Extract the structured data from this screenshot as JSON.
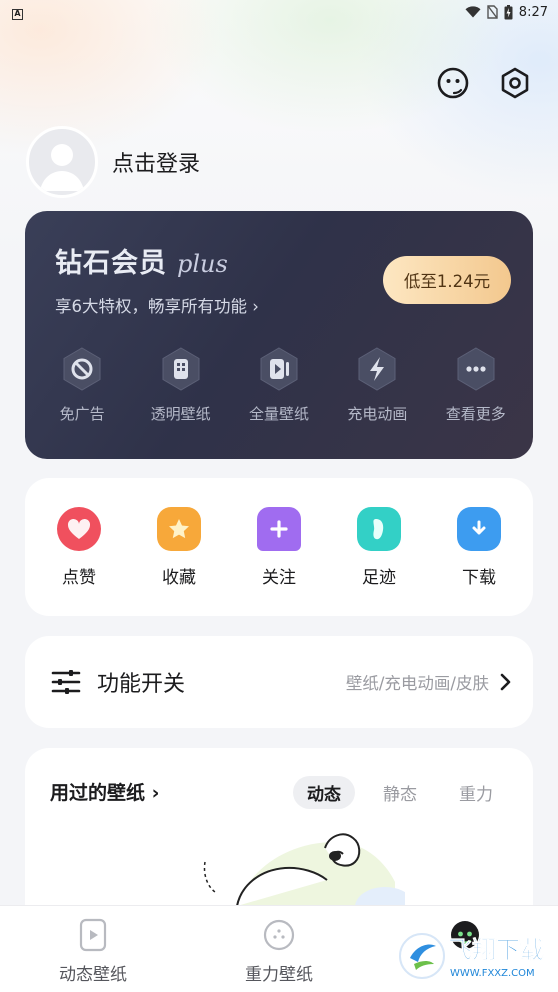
{
  "status_bar": {
    "time": "8:27",
    "app_mark": "A"
  },
  "profile": {
    "login_text": "点击登录"
  },
  "vip": {
    "title": "钻石会员",
    "title_suffix": "plus",
    "subtitle": "享6大特权，畅享所有功能 ›",
    "price_button": "低至1.24元",
    "perks": [
      {
        "label": "免广告",
        "icon": "no-ads-icon"
      },
      {
        "label": "透明壁纸",
        "icon": "transparent-wallpaper-icon"
      },
      {
        "label": "全量壁纸",
        "icon": "all-wallpapers-icon"
      },
      {
        "label": "充电动画",
        "icon": "charging-bolt-icon"
      },
      {
        "label": "查看更多",
        "icon": "more-dots-icon"
      }
    ]
  },
  "quick_actions": [
    {
      "label": "点赞",
      "icon": "heart-icon",
      "color": "#f0505e"
    },
    {
      "label": "收藏",
      "icon": "star-icon",
      "color": "#f7a83a"
    },
    {
      "label": "关注",
      "icon": "bookmark-plus-icon",
      "color": "#a06cf0"
    },
    {
      "label": "足迹",
      "icon": "footprint-icon",
      "color": "#33d0c6"
    },
    {
      "label": "下载",
      "icon": "download-folder-icon",
      "color": "#3d9cf0"
    }
  ],
  "feature_switch": {
    "title": "功能开关",
    "hint": "壁纸/充电动画/皮肤"
  },
  "history": {
    "title": "用过的壁纸",
    "tabs": [
      "动态",
      "静态",
      "重力"
    ],
    "active_tab": "动态"
  },
  "tabbar": {
    "items": [
      {
        "label": "动态壁纸",
        "icon": "dynamic-wallpaper-icon"
      },
      {
        "label": "重力壁纸",
        "icon": "gravity-wallpaper-icon"
      },
      {
        "label": "",
        "icon": "profile-face-icon"
      }
    ]
  },
  "watermark": {
    "text": "飞翔下载",
    "url": "WWW.FXXZ.COM"
  }
}
